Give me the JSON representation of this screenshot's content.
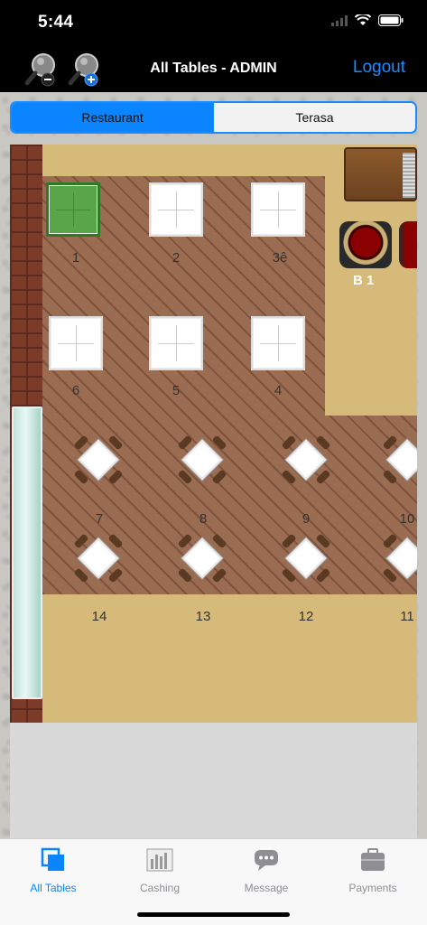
{
  "status_bar": {
    "time": "5:44"
  },
  "nav": {
    "title": "All Tables - ADMIN",
    "logout_label": "Logout",
    "zoom_out_icon": "zoom-out-icon",
    "zoom_in_icon": "zoom-in-icon"
  },
  "segments": [
    {
      "label": "Restaurant",
      "selected": true
    },
    {
      "label": "Terasa",
      "selected": false
    }
  ],
  "tables": {
    "square": [
      {
        "label": "1",
        "occupied": true
      },
      {
        "label": "2",
        "occupied": false
      },
      {
        "label": "3ê",
        "occupied": false
      },
      {
        "label": "6",
        "occupied": false
      },
      {
        "label": "5",
        "occupied": false
      },
      {
        "label": "4",
        "occupied": false
      }
    ],
    "diamond": [
      {
        "label": "7"
      },
      {
        "label": "8"
      },
      {
        "label": "9"
      },
      {
        "label": "10"
      },
      {
        "label": "14"
      },
      {
        "label": "13"
      },
      {
        "label": "12"
      },
      {
        "label": "11"
      }
    ],
    "bar": {
      "label": "B 1"
    }
  },
  "tabs": [
    {
      "label": "All Tables",
      "icon": "tables-icon",
      "active": true
    },
    {
      "label": "Cashing",
      "icon": "cashing-icon",
      "active": false
    },
    {
      "label": "Message",
      "icon": "message-icon",
      "active": false
    },
    {
      "label": "Payments",
      "icon": "payments-icon",
      "active": false
    }
  ],
  "colors": {
    "accent": "#0a84ff",
    "occupied_table": "#5aa54a",
    "floor_sand": "#d5ba7a",
    "parquet": "#9a6c52"
  }
}
